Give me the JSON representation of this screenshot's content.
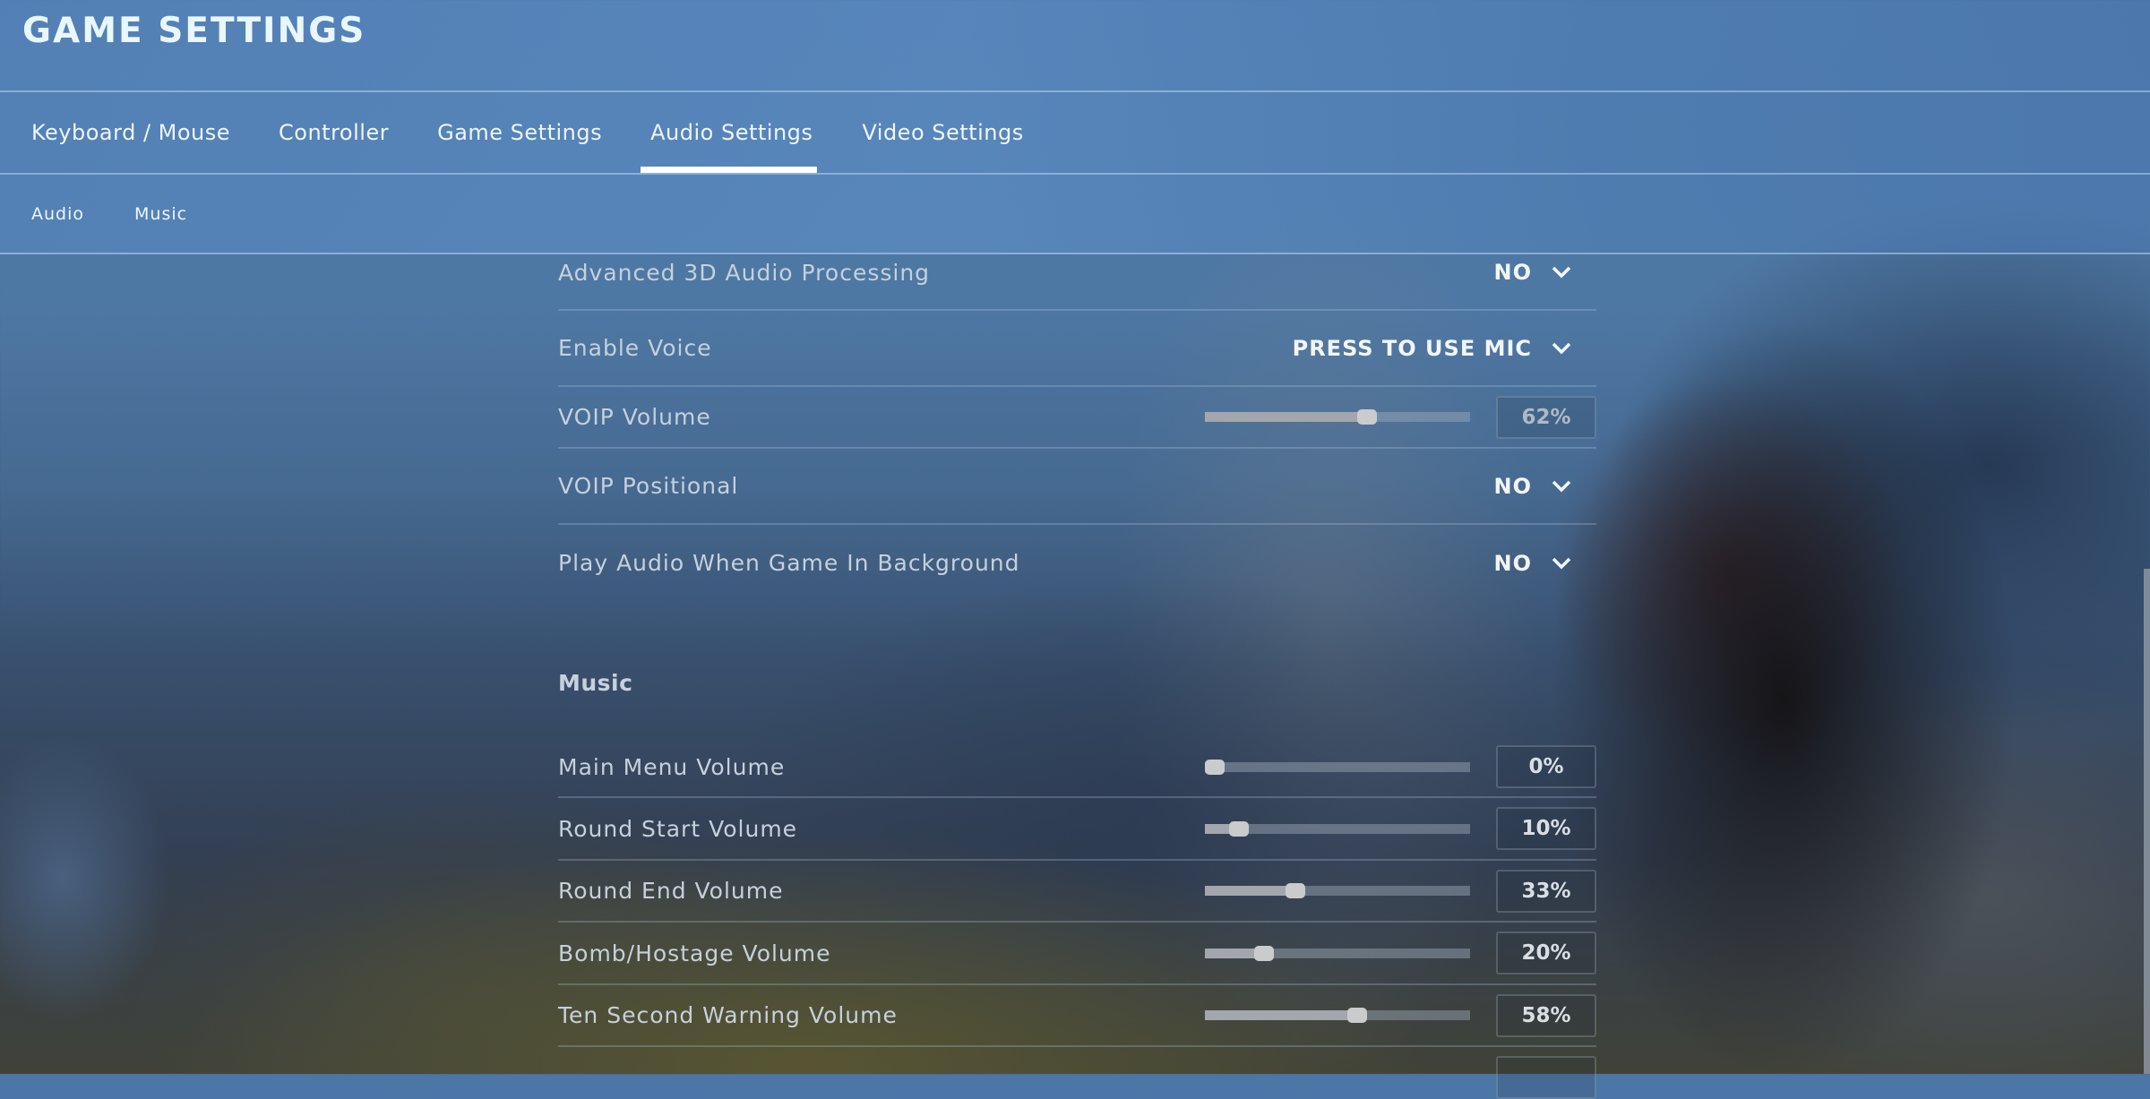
{
  "header": {
    "title": "GAME SETTINGS"
  },
  "tabs": [
    {
      "label": "Keyboard / Mouse",
      "active": false
    },
    {
      "label": "Controller",
      "active": false
    },
    {
      "label": "Game Settings",
      "active": false
    },
    {
      "label": "Audio Settings",
      "active": true
    },
    {
      "label": "Video Settings",
      "active": false
    }
  ],
  "subtabs": [
    {
      "label": "Audio"
    },
    {
      "label": "Music"
    }
  ],
  "audio_settings": [
    {
      "label": "Advanced 3D Audio Processing",
      "type": "dropdown",
      "value": "NO"
    },
    {
      "label": "Enable Voice",
      "type": "dropdown",
      "value": "PRESS TO USE MIC"
    },
    {
      "label": "VOIP Volume",
      "type": "slider",
      "value": 62,
      "display": "62%"
    },
    {
      "label": "VOIP Positional",
      "type": "dropdown",
      "value": "NO"
    },
    {
      "label": "Play Audio When Game In Background",
      "type": "dropdown",
      "value": "NO"
    }
  ],
  "music_section": {
    "title": "Music",
    "settings": [
      {
        "label": "Main Menu Volume",
        "type": "slider",
        "value": 0,
        "display": "0%"
      },
      {
        "label": "Round Start Volume",
        "type": "slider",
        "value": 10,
        "display": "10%"
      },
      {
        "label": "Round End Volume",
        "type": "slider",
        "value": 33,
        "display": "33%"
      },
      {
        "label": "Bomb/Hostage Volume",
        "type": "slider",
        "value": 20,
        "display": "20%"
      },
      {
        "label": "Ten Second Warning Volume",
        "type": "slider",
        "value": 58,
        "display": "58%"
      }
    ]
  },
  "icons": {
    "dropdown": "chevron-down-icon"
  },
  "colors": {
    "header_bg": "#5a8ac4",
    "active_tab_underline": "#ffffff",
    "title_text": "#e9f7ff",
    "label_text": "#c6d0dc",
    "slider_fill": "#a3a7ad",
    "slider_thumb": "#cacbcd"
  }
}
